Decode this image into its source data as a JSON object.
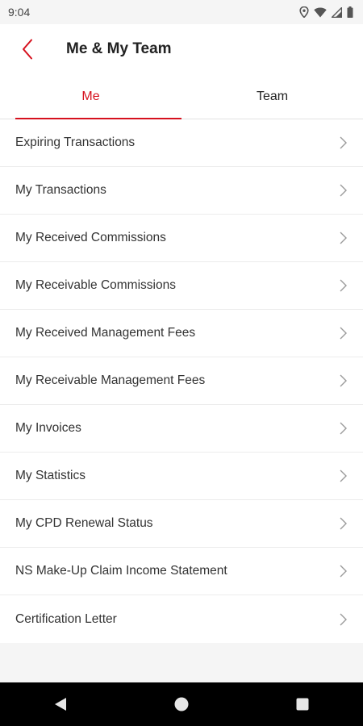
{
  "status_bar": {
    "time": "9:04",
    "icons": [
      "location-icon",
      "wifi-icon",
      "signal-icon",
      "battery-icon"
    ]
  },
  "app_bar": {
    "title": "Me & My Team",
    "back_icon": "chevron-left-icon"
  },
  "tabs": [
    {
      "label": "Me",
      "active": true
    },
    {
      "label": "Team",
      "active": false
    }
  ],
  "menu": {
    "items": [
      {
        "label": "Expiring Transactions"
      },
      {
        "label": "My Transactions"
      },
      {
        "label": "My Received Commissions"
      },
      {
        "label": "My Receivable Commissions"
      },
      {
        "label": "My Received Management Fees"
      },
      {
        "label": "My Receivable Management Fees"
      },
      {
        "label": "My Invoices"
      },
      {
        "label": "My Statistics"
      },
      {
        "label": "My CPD Renewal Status"
      },
      {
        "label": "NS Make-Up Claim Income Statement"
      },
      {
        "label": "Certification Letter"
      }
    ]
  },
  "nav_bar": {
    "buttons": [
      "back-triangle-icon",
      "home-circle-icon",
      "recents-square-icon"
    ]
  },
  "colors": {
    "accent": "#d6111e",
    "background": "#f5f5f5",
    "text": "#333333"
  }
}
